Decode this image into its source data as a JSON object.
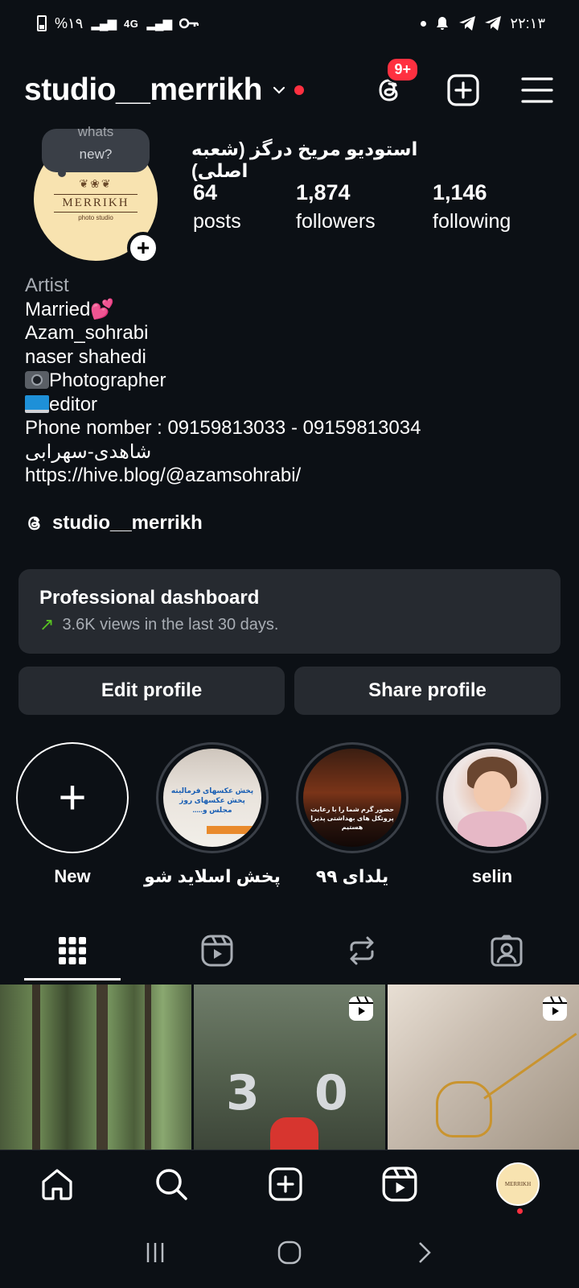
{
  "status_bar": {
    "battery": "%۱۹",
    "network": "4G",
    "time": "۲۲:۱۳"
  },
  "header": {
    "username": "studio__merrikh",
    "threads_badge": "9+"
  },
  "profile": {
    "note_prev": "whats",
    "note_text": "new?",
    "logo_name": "MERRIKH",
    "logo_sub": "photo studio",
    "display_name": "استودیو مریخ درگز (شعبه اصلی)",
    "stats": [
      {
        "num": "64",
        "label": "posts"
      },
      {
        "num": "1,874",
        "label": "followers"
      },
      {
        "num": "1,146",
        "label": "following"
      }
    ],
    "bio": {
      "category": "Artist",
      "line1": "Married",
      "line2": "Azam_sohrabi",
      "line3": "naser shahedi",
      "line4": "Photographer",
      "line5": "editor",
      "line6": "Phone  nomber : 09159813033  -  09159813034",
      "line7": "شاهدی-سهرابی",
      "line8": "https://hive.blog/@azamsohrabi/"
    },
    "threads_handle": "studio__merrikh"
  },
  "dashboard": {
    "title": "Professional dashboard",
    "subtitle": "3.6K views in the last 30 days."
  },
  "buttons": {
    "edit": "Edit profile",
    "share": "Share profile"
  },
  "highlights": [
    {
      "label": "New"
    },
    {
      "label": "پخش اسلاید شو",
      "caption": "پخش عکسهای فرمالیته پخش عکسهای روز مجلس و....."
    },
    {
      "label": "یلدای ۹۹",
      "caption": "حضور گرم شما را با رعایت پروتکل های بهداشتی پذیرا هستیم"
    },
    {
      "label": "selin"
    }
  ],
  "colors": {
    "background": "#0c1015",
    "card": "#262a30",
    "accent_red": "#ff3040",
    "trend_green": "#58c322",
    "muted_text": "#a8adb4"
  }
}
